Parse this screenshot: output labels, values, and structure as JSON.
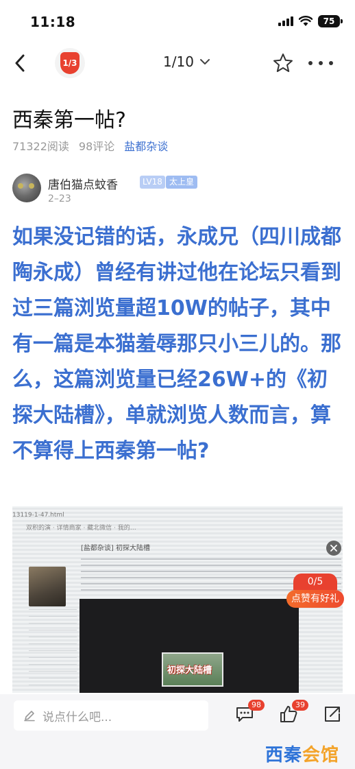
{
  "status": {
    "time": "11:18",
    "battery": "75"
  },
  "nav": {
    "page_badge": "1/3",
    "page_selector": "1/10",
    "back_icon": "chevron-left-icon",
    "star_icon": "star-outline-icon",
    "more_icon": "more-horizontal-icon"
  },
  "post": {
    "title": "西秦第一帖?",
    "reads": "71322阅读",
    "comments": "98评论",
    "forum": "盐都杂谈"
  },
  "author": {
    "name": "唐伯猫点蚊香",
    "level": "LV18",
    "rank": "太上皇",
    "date": "2–23"
  },
  "body": {
    "text": "如果没记错的话，永成兄（四川成都陶永成）曾经有讲过他在论坛只看到过三篇浏览量超10W的帖子，其中有一篇是本猫羞辱那只小三儿的。那么，这篇浏览量已经26W+的《初探大陆槽》，单就浏览人数而言，算不算得上西秦第一帖?"
  },
  "image": {
    "url_text": "13119-1-47.html",
    "tabs_text": "双积的演 · 详情商家 · 藏北微信 · 我的…",
    "post_header": "[盐都杂谈] 初探大陆槽",
    "inner_text": "初探大陆槽"
  },
  "reward": {
    "count": "0/5",
    "label": "点赞有好礼"
  },
  "bottom": {
    "comment_placeholder": "说点什么吧...",
    "comment_count": "98",
    "like_count": "39"
  },
  "watermark": {
    "part1": "西秦",
    "part2": "会馆"
  },
  "colors": {
    "accent_blue": "#3b6fd0",
    "badge_red": "#e8412f",
    "reward_orange": "#f36c2b"
  }
}
